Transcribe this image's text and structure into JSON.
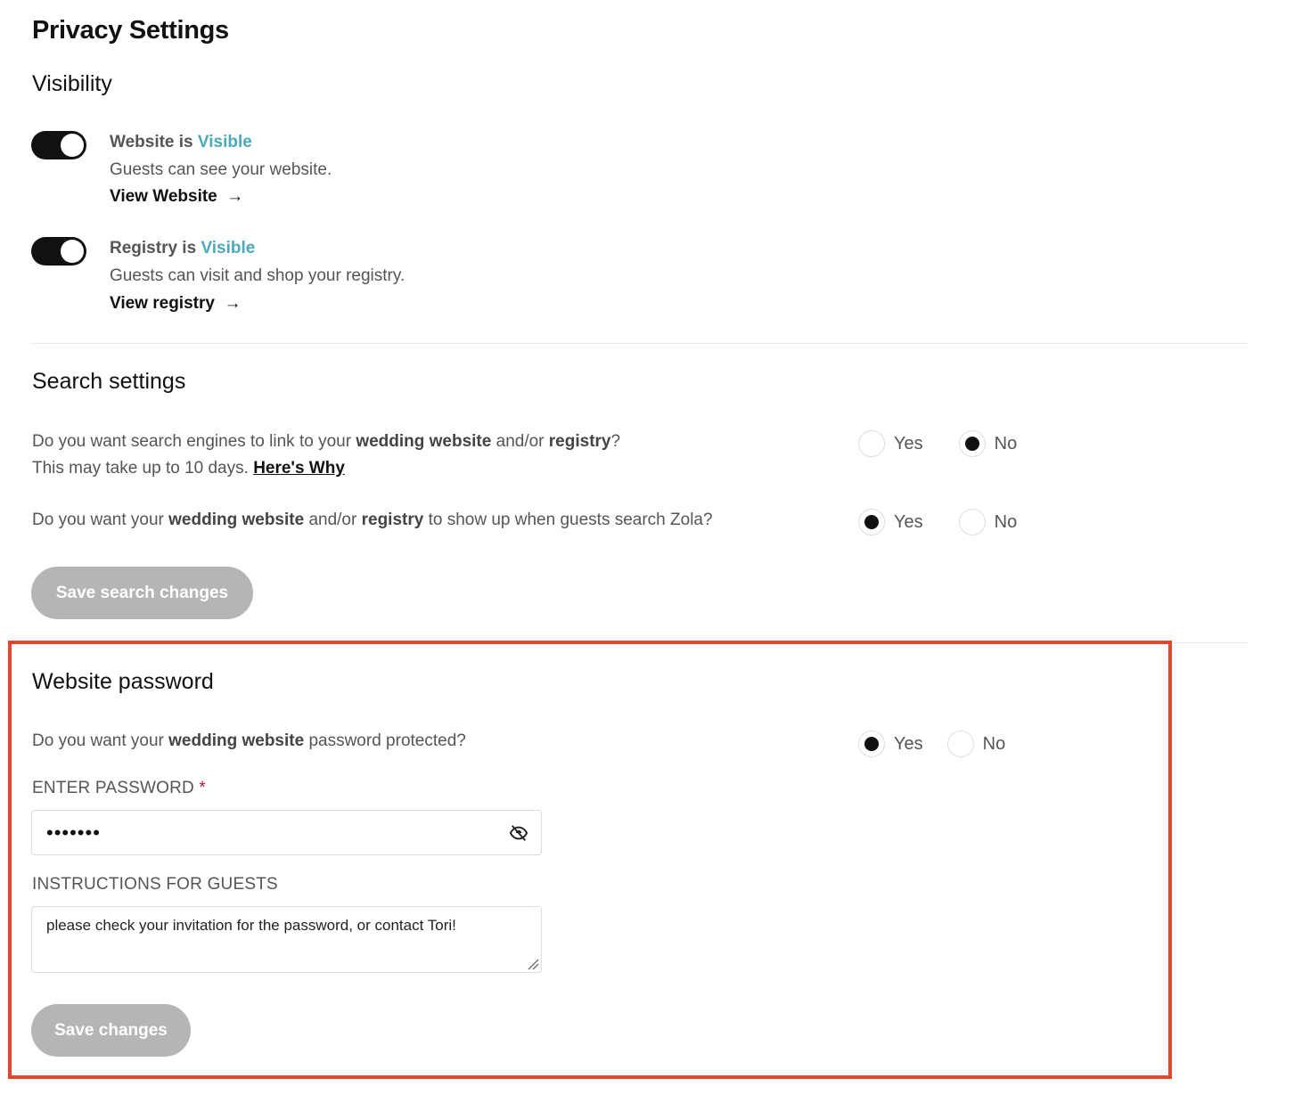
{
  "page": {
    "title": "Privacy Settings"
  },
  "visibility": {
    "heading": "Visibility",
    "items": [
      {
        "name": "website",
        "toggle_on": true,
        "title_prefix": "Website is",
        "status": "Visible",
        "description": "Guests can see your website.",
        "link_label": "View Website",
        "link_icon": "arrow-right-icon"
      },
      {
        "name": "registry",
        "toggle_on": true,
        "title_prefix": "Registry is",
        "status": "Visible",
        "description": "Guests can visit and shop your registry.",
        "link_label": "View registry",
        "link_icon": "arrow-right-icon"
      }
    ],
    "accent_color": "#4aaab8"
  },
  "search": {
    "heading": "Search settings",
    "q1": {
      "parts": [
        "Do you want search engines to link to your ",
        "wedding website",
        " and/or ",
        "registry",
        "?"
      ],
      "line2": "This may take up to 10 days. ",
      "link": "Here's Why",
      "options": [
        "Yes",
        "No"
      ],
      "selected": "No"
    },
    "q2": {
      "parts": [
        "Do you want your ",
        "wedding website",
        " and/or ",
        "registry",
        " to show up when guests search Zola?"
      ],
      "options": [
        "Yes",
        "No"
      ],
      "selected": "Yes"
    },
    "save_label": "Save search changes"
  },
  "password": {
    "heading": "Website password",
    "question": {
      "parts": [
        "Do you want your ",
        "wedding website",
        " password protected?"
      ],
      "options": [
        "Yes",
        "No"
      ],
      "selected": "Yes"
    },
    "password_label": "ENTER PASSWORD",
    "required_mark": "*",
    "password_value": "•••••••",
    "visibility_icon": "eye-slash-icon",
    "instructions_label": "INSTRUCTIONS FOR GUESTS",
    "instructions_value": "please check your invitation for the password, or contact Tori!",
    "save_label": "Save changes"
  },
  "highlight_color": "#e8442b"
}
